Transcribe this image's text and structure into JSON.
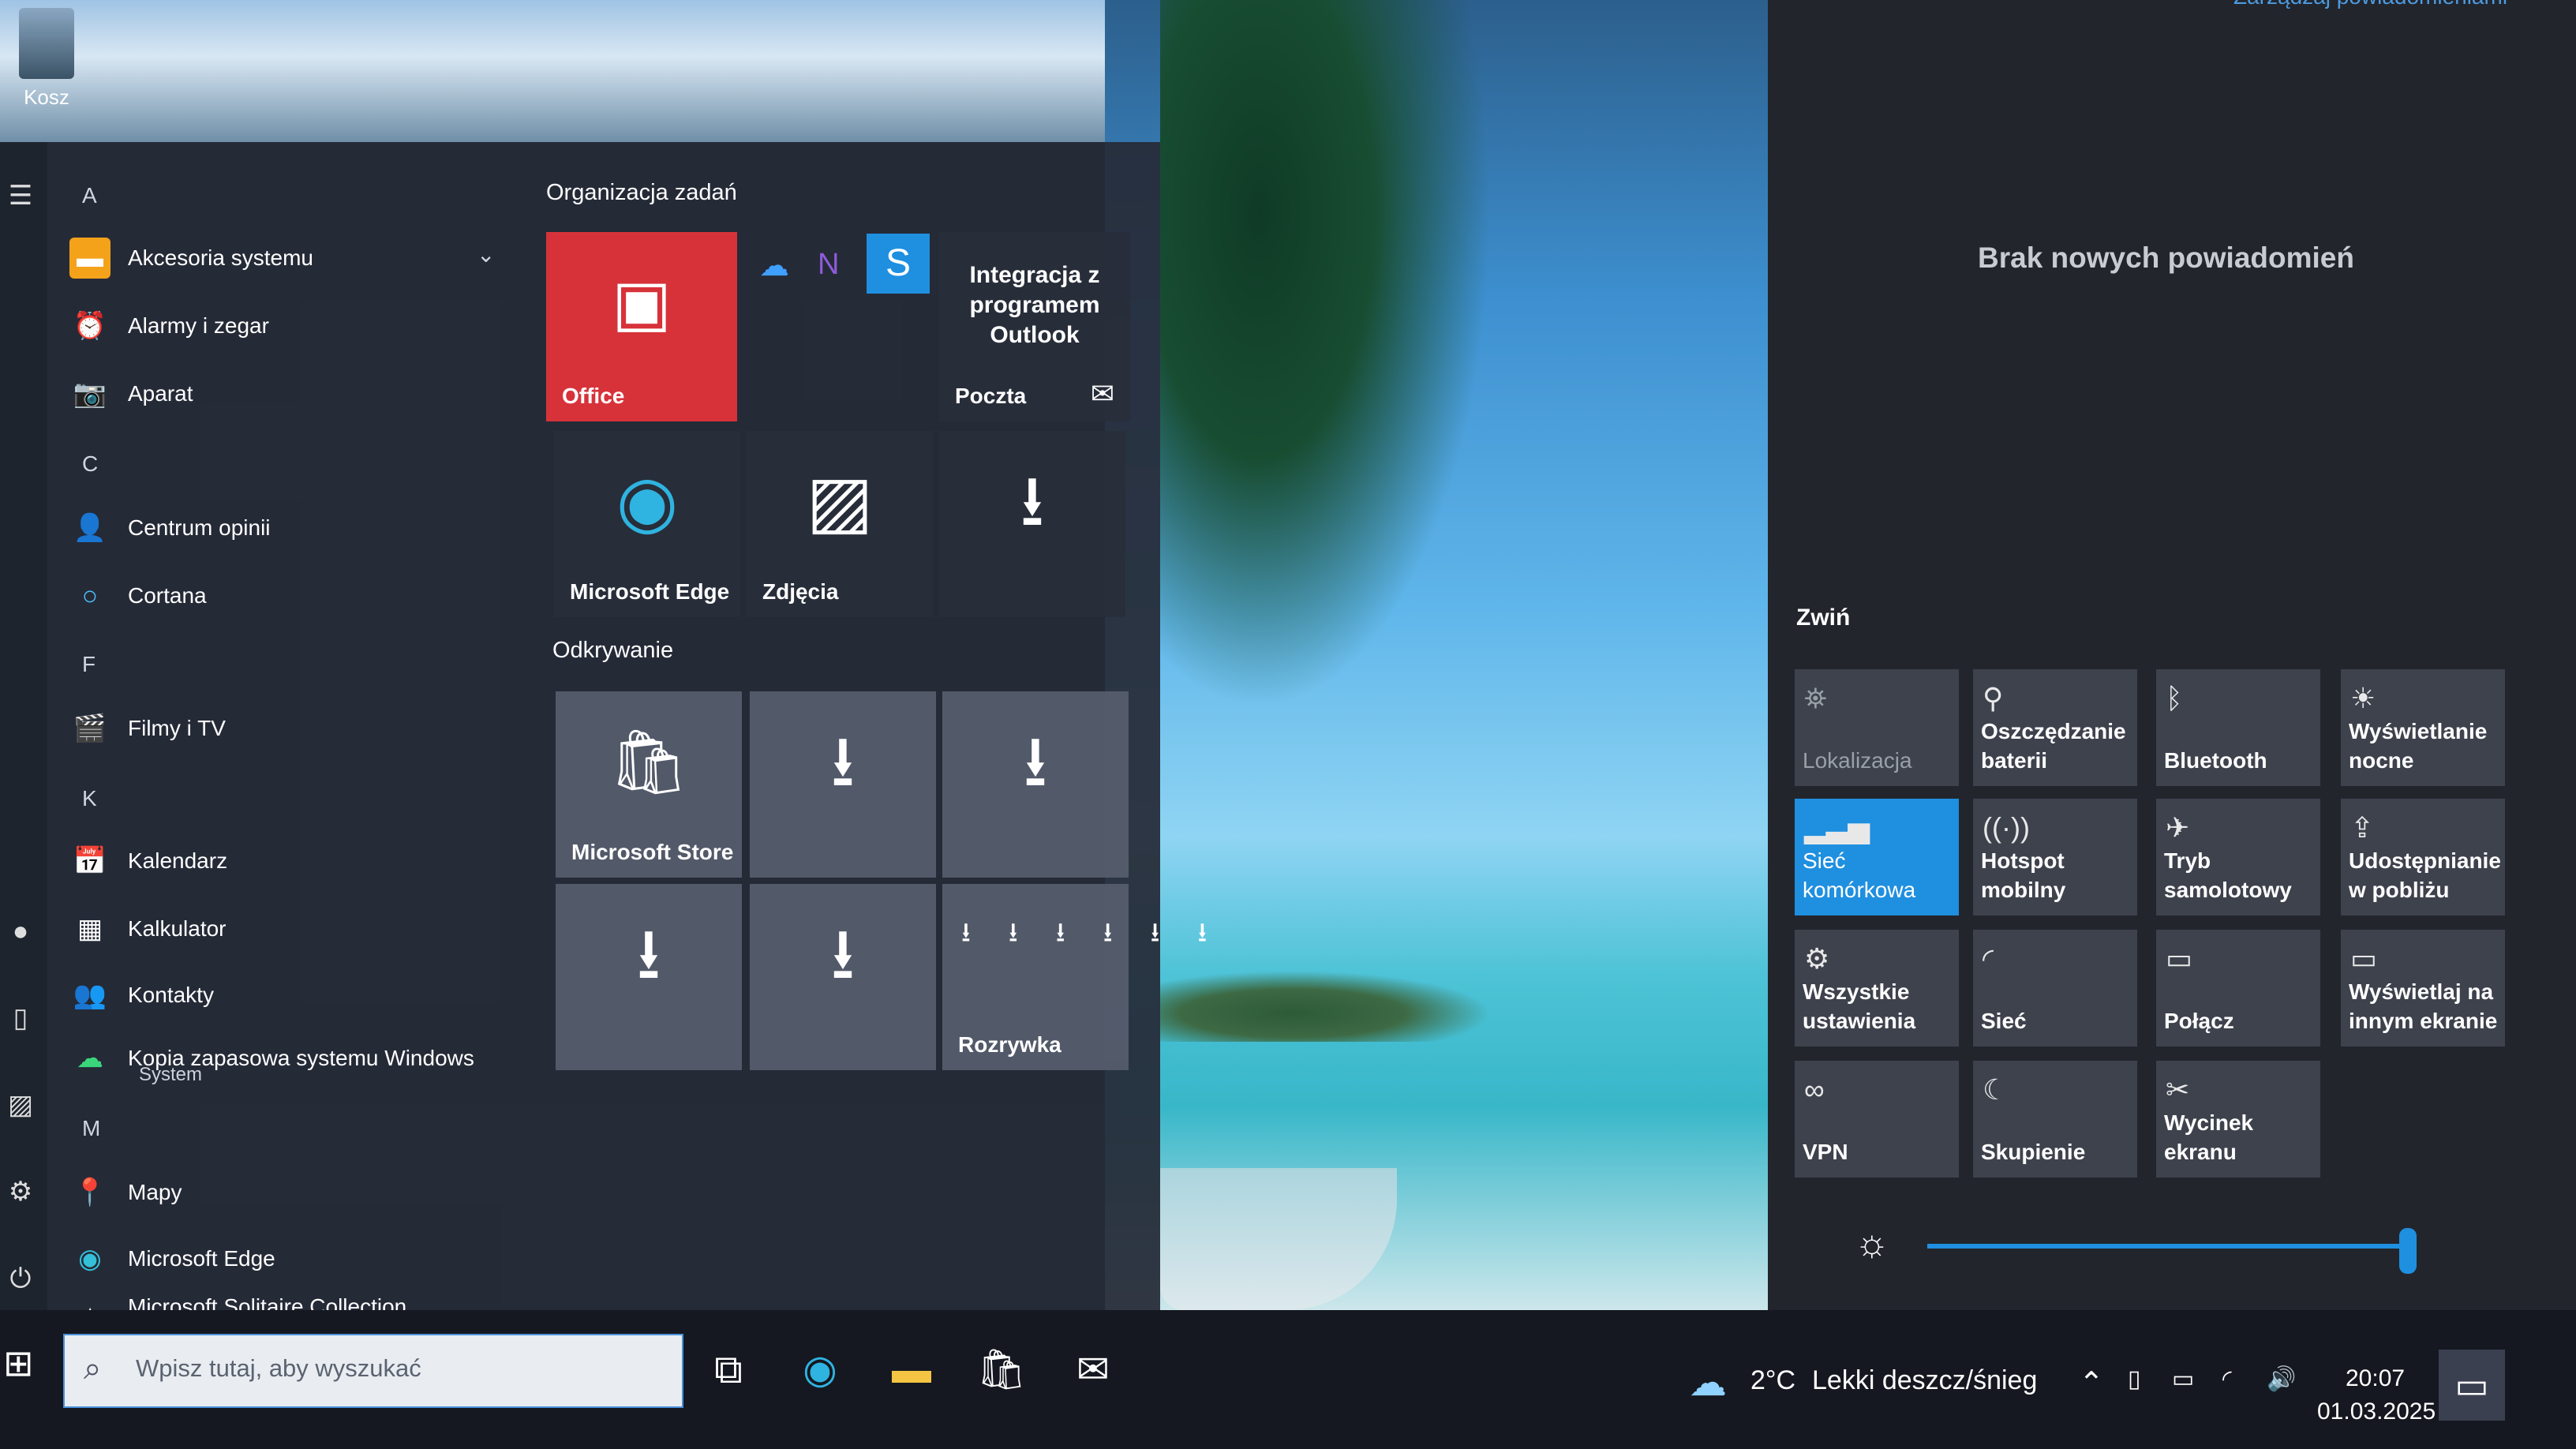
{
  "desktop": {
    "recycle_bin_label": "Kosz"
  },
  "start_menu": {
    "sections": [
      {
        "letter": "A",
        "apps": [
          {
            "label": "Akcesoria systemu",
            "icon": "folder-icon"
          },
          {
            "label": "Alarmy i zegar",
            "icon": "alarm-clock-icon"
          },
          {
            "label": "Aparat",
            "icon": "camera-icon"
          }
        ]
      },
      {
        "letter": "C",
        "apps": [
          {
            "label": "Centrum opinii",
            "icon": "feedback-icon"
          },
          {
            "label": "Cortana",
            "icon": "cortana-icon"
          }
        ]
      },
      {
        "letter": "F",
        "apps": [
          {
            "label": "Filmy i TV",
            "icon": "film-icon"
          }
        ]
      },
      {
        "letter": "K",
        "apps": [
          {
            "label": "Kalendarz",
            "icon": "calendar-icon"
          },
          {
            "label": "Kalkulator",
            "icon": "calculator-icon"
          },
          {
            "label": "Kontakty",
            "icon": "contacts-icon"
          },
          {
            "label": "Kopia zapasowa systemu Windows",
            "sub": "System",
            "icon": "backup-icon"
          }
        ]
      },
      {
        "letter": "M",
        "apps": [
          {
            "label": "Mapy",
            "icon": "maps-icon"
          },
          {
            "label": "Microsoft Edge",
            "icon": "edge-icon"
          },
          {
            "label": "Microsoft Solitaire Collection",
            "icon": "solitaire-icon"
          }
        ]
      }
    ],
    "group1_title": "Organizacja zadań",
    "group2_title": "Odkrywanie",
    "tiles": {
      "office": "Office",
      "outlook_integration": "Integracja z programem Outlook",
      "mail": "Poczta",
      "edge": "Microsoft Edge",
      "photos": "Zdjęcia",
      "store": "Microsoft Store",
      "games": "Rozrywka"
    }
  },
  "action_center": {
    "manage_link": "Zarządzaj powiadomieniami",
    "no_notifications": "Brak nowych powiadomień",
    "collapse": "Zwiń",
    "quick_actions": [
      {
        "label": "Lokalizacja",
        "icon": "location-icon",
        "state": "off"
      },
      {
        "label": "Oszczędzanie baterii",
        "icon": "battery-saver-icon",
        "state": "normal"
      },
      {
        "label": "Bluetooth",
        "icon": "bluetooth-icon",
        "state": "normal"
      },
      {
        "label": "Wyświetlanie nocne",
        "icon": "night-light-icon",
        "state": "normal"
      },
      {
        "label": "Sieć komórkowa",
        "icon": "cellular-icon",
        "state": "active"
      },
      {
        "label": "Hotspot mobilny",
        "icon": "hotspot-icon",
        "state": "normal"
      },
      {
        "label": "Tryb samolotowy",
        "icon": "airplane-icon",
        "state": "normal"
      },
      {
        "label": "Udostępnianie w pobliżu",
        "icon": "nearby-share-icon",
        "state": "normal"
      },
      {
        "label": "Wszystkie ustawienia",
        "icon": "settings-icon",
        "state": "normal"
      },
      {
        "label": "Sieć",
        "icon": "network-icon",
        "state": "normal"
      },
      {
        "label": "Połącz",
        "icon": "connect-icon",
        "state": "normal"
      },
      {
        "label": "Wyświetlaj na innym ekranie",
        "icon": "project-icon",
        "state": "normal"
      },
      {
        "label": "VPN",
        "icon": "vpn-icon",
        "state": "normal"
      },
      {
        "label": "Skupienie",
        "icon": "focus-icon",
        "state": "normal"
      },
      {
        "label": "Wycinek ekranu",
        "icon": "snip-icon",
        "state": "normal"
      }
    ],
    "brightness_percent": 100,
    "accent_color": "#1f8fe0"
  },
  "taskbar": {
    "search_placeholder": "Wpisz tutaj, aby wyszukać",
    "weather_temp": "2°C",
    "weather_desc": "Lekki deszcz/śnieg",
    "time": "20:07",
    "date": "01.03.2025"
  }
}
